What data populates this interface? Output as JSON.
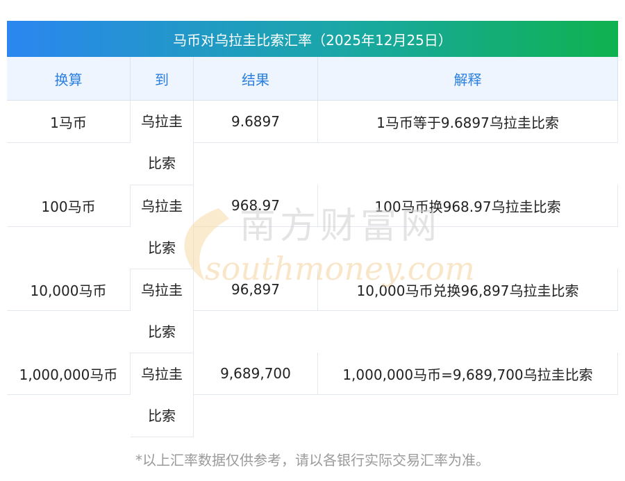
{
  "title": "马币对乌拉圭比索汇率（2025年12月25日）",
  "headers": [
    "换算",
    "到",
    "结果",
    "解释"
  ],
  "rows": [
    {
      "amount": "1马币",
      "target1": "乌拉圭",
      "target2": "比索",
      "result": "9.6897",
      "explain": "1马币等于9.6897乌拉圭比索"
    },
    {
      "amount": "100马币",
      "target1": "乌拉圭",
      "target2": "比索",
      "result": "968.97",
      "explain": "100马币换968.97乌拉圭比索"
    },
    {
      "amount": "10,000马币",
      "target1": "乌拉圭",
      "target2": "比索",
      "result": "96,897",
      "explain": "10,000马币兑换96,897乌拉圭比索"
    },
    {
      "amount": "1,000,000马币",
      "target1": "乌拉圭",
      "target2": "比索",
      "result": "9,689,700",
      "explain": "1,000,000马币=9,689,700乌拉圭比索"
    }
  ],
  "watermark": {
    "cn": "南方财富网",
    "en": "southmoney.com"
  },
  "footnote": "*以上汇率数据仅供参考，请以各银行实际交易汇率为准。"
}
